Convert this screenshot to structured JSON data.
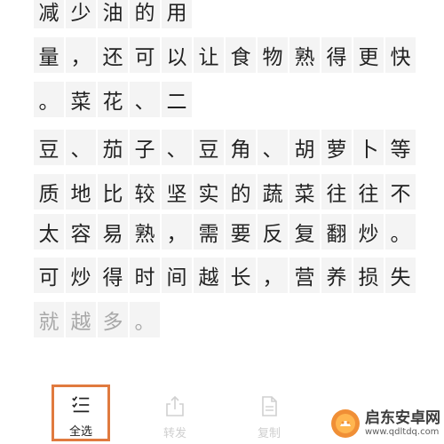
{
  "text_lines": [
    {
      "chars": [
        "减",
        "少",
        "油",
        "的",
        "用"
      ],
      "dim": false
    },
    {
      "chars": [
        "量",
        "，",
        "还",
        "可",
        "以",
        "让",
        "食",
        "物",
        "熟",
        "得",
        "更",
        "快"
      ],
      "dim": false
    },
    {
      "chars": [
        "。",
        "菜",
        "花",
        "、",
        "二"
      ],
      "dim": false
    },
    {
      "chars": [
        "豆",
        "、",
        "茄",
        "子",
        "、",
        "豆",
        "角",
        "、",
        "胡",
        "萝",
        "卜",
        "等"
      ],
      "dim": false
    },
    {
      "chars": [
        "质",
        "地",
        "比",
        "较",
        "坚",
        "实",
        "的",
        "蔬",
        "菜",
        "往",
        "往",
        "不"
      ],
      "dim": false
    },
    {
      "chars": [
        "太",
        "容",
        "易",
        "熟",
        "，",
        "需",
        "要",
        "反",
        "复",
        "翻",
        "炒",
        "。"
      ],
      "dim": false
    },
    {
      "chars": [
        "可",
        "炒",
        "得",
        "时",
        "间",
        "越",
        "长",
        "，",
        "营",
        "养",
        "损",
        "失"
      ],
      "dim": false
    },
    {
      "chars": [
        "就",
        "越",
        "多",
        "。"
      ],
      "dim": true
    }
  ],
  "toolbar": {
    "select_all": {
      "label": "全选",
      "icon": "checklist-icon"
    },
    "forward": {
      "label": "转发",
      "icon": "share-icon"
    },
    "copy": {
      "label": "复制",
      "icon": "document-icon"
    },
    "accent_color": "#e07a3f"
  },
  "watermark": {
    "title": "启东安卓网",
    "url": "www.qdltdq.com"
  }
}
